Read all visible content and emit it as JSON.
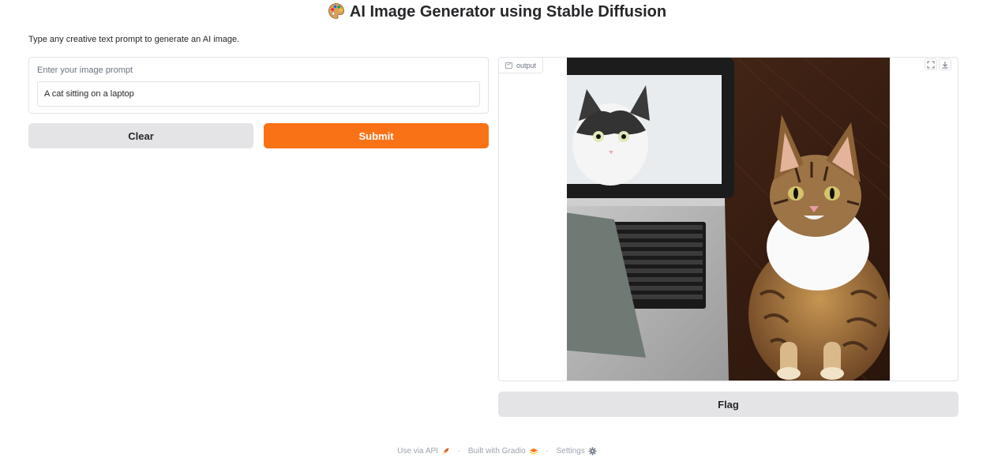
{
  "header": {
    "emoji_icon": "palette-icon",
    "title": "AI Image Generator using Stable Diffusion"
  },
  "description": "Type any creative text prompt to generate an AI image.",
  "input": {
    "label": "Enter your image prompt",
    "value": "A cat sitting on a laptop"
  },
  "buttons": {
    "clear_label": "Clear",
    "submit_label": "Submit",
    "flag_label": "Flag"
  },
  "output": {
    "label": "output",
    "label_icon": "image-icon",
    "tools": [
      "fullscreen-icon",
      "download-icon"
    ]
  },
  "footer": {
    "api_label": "Use via API",
    "api_icon": "rocket-icon",
    "built_label": "Built with Gradio",
    "built_icon": "gradio-logo-icon",
    "settings_label": "Settings",
    "settings_icon": "gear-icon",
    "separator": "·"
  },
  "colors": {
    "accent": "#f97316",
    "secondary_button": "#e4e4e7",
    "border": "#e4e4e7",
    "muted_text": "#9ca3af"
  }
}
